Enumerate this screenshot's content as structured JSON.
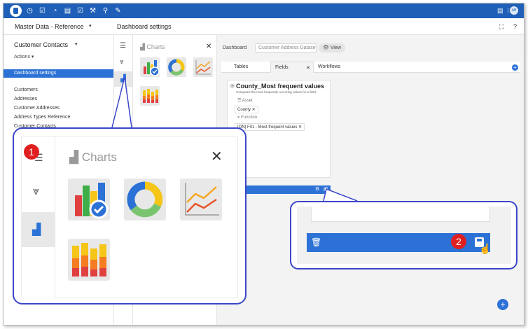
{
  "topbar": {
    "icons": [
      "database-icon",
      "clock-icon",
      "check-icon",
      "gauge-icon",
      "list-icon",
      "checklist-icon",
      "wrench-icon",
      "search-icon",
      "tools-icon"
    ],
    "avatar": "AB"
  },
  "subheader": {
    "app_name": "Master Data - Reference",
    "page_title": "Dashboard settings"
  },
  "left_panel": {
    "title": "Customer Contacts",
    "actions": "Actions",
    "active_item": "Dashboard settings",
    "items": [
      "Customers",
      "Addresses",
      "Customer Addresses",
      "Address Types Reference",
      "Customer Contacts"
    ]
  },
  "charts_panel": {
    "title": "Charts"
  },
  "content": {
    "crumb": "Dashboard",
    "asset_select": "Customer Address Datase",
    "view_button": "View",
    "tabs": [
      {
        "label": "Tables"
      },
      {
        "label": "Fields"
      },
      {
        "label": "Workflows"
      }
    ],
    "card": {
      "title": "County_Most frequent values",
      "subtitle": "Computes the most frequently occurring values for a field.",
      "asset_label": "Asset",
      "asset_chip": "County",
      "function_label": "Function",
      "function_chip": "[ON] F01 - Most frequent values"
    }
  },
  "callouts": {
    "one": {
      "number": "1",
      "title": "Charts"
    },
    "two": {
      "number": "2"
    }
  },
  "colors": {
    "primary": "#2c72d6",
    "topbar": "#1f5fb8",
    "callout_border": "#3b46c8",
    "badge": "#e02020"
  }
}
